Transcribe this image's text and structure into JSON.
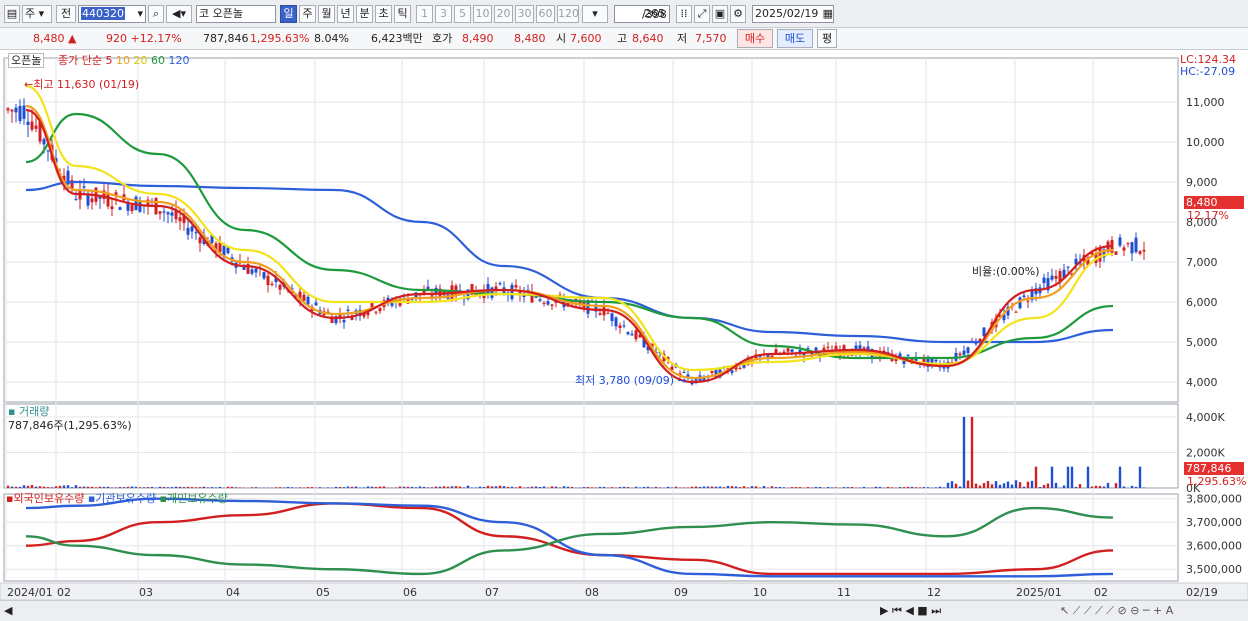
{
  "toolbar": {
    "market": "주",
    "market2": "전",
    "code": "440320",
    "prefix": "코",
    "name": "오픈놀",
    "periods": [
      "일",
      "주",
      "월",
      "년",
      "분",
      "초",
      "틱"
    ],
    "intervals": [
      "1",
      "3",
      "5",
      "10",
      "20",
      "30",
      "60",
      "120"
    ],
    "count": "265",
    "total": "/398",
    "date": "2025/02/19"
  },
  "quote": {
    "price": "8,480",
    "change_arrow": "▲",
    "change": "920",
    "change_pct": "+12.17%",
    "volume": "787,846",
    "volume_pct": "1,295.63%",
    "turnover": "8.04%",
    "amount": "6,423백만",
    "bid_label": "호가",
    "bid1": "8,490",
    "bid2": "8,480",
    "open_label": "시",
    "open": "7,600",
    "high_label": "고",
    "high": "8,640",
    "low_label": "저",
    "low": "7,570",
    "buy": "매수",
    "sell": "매도",
    "eval": "평"
  },
  "price_panel": {
    "legend_name": "오픈놀",
    "legend_title": "종가 단순",
    "ma_periods": [
      "5",
      "10",
      "20",
      "60",
      "120"
    ],
    "ma_colors": [
      "#d21f1f",
      "#f0a020",
      "#f2e31a",
      "#1e9a3c",
      "#2e5fd8"
    ],
    "high_marker": "최고 11,630 (01/19)",
    "low_marker": "최저 3,780 (09/09)",
    "note": "비율:",
    "note2": "(0.00%)",
    "lc": "LC:124.34",
    "hc": "HC:-27.09",
    "last_price": "8,480",
    "last_pct": "12.17%",
    "y_ticks": [
      "11,000",
      "10,000",
      "9,000",
      "8,000",
      "7,000",
      "6,000",
      "5,000",
      "4,000"
    ]
  },
  "volume_panel": {
    "title": "거래량",
    "info": "787,846주(1,295.63%)",
    "y_ticks": [
      "4,000K",
      "2,000K",
      "0K"
    ],
    "last": "787,846",
    "last_pct": "1,295.63%"
  },
  "holdings_panel": {
    "series": [
      "외국인보유수량",
      "기관보유수량",
      "개인보유수량"
    ],
    "colors": [
      "#d21f1f",
      "#2e5fd8",
      "#2f8f4f"
    ],
    "y_ticks": [
      "3,800,000",
      "3,700,000",
      "3,600,000",
      "3,500,000"
    ]
  },
  "x_axis": [
    "2024/01",
    "02",
    "03",
    "04",
    "05",
    "06",
    "07",
    "08",
    "09",
    "10",
    "11",
    "12",
    "2025/01",
    "02",
    "02/19"
  ],
  "chart_data": [
    {
      "type": "candlestick",
      "title": "종가 단순",
      "series": [
        {
          "name": "5",
          "x": [
            "2024/01",
            "02",
            "03",
            "04",
            "05",
            "06",
            "07",
            "08",
            "09",
            "10",
            "11",
            "12",
            "2025/01",
            "02"
          ],
          "values": [
            10800,
            8700,
            8400,
            6900,
            5600,
            6200,
            6300,
            5800,
            4000,
            4700,
            4800,
            4400,
            6300,
            7400
          ]
        },
        {
          "name": "10",
          "x": [
            "2024/01",
            "02",
            "03",
            "04",
            "05",
            "06",
            "07",
            "08",
            "09",
            "10",
            "11",
            "12",
            "2025/01",
            "02"
          ],
          "values": [
            10900,
            8800,
            8500,
            7000,
            5700,
            6100,
            6300,
            5900,
            4100,
            4600,
            4750,
            4400,
            6100,
            7300
          ]
        },
        {
          "name": "20",
          "x": [
            "2024/01",
            "02",
            "03",
            "04",
            "05",
            "06",
            "07",
            "08",
            "09",
            "10",
            "11",
            "12",
            "2025/01",
            "02"
          ],
          "values": [
            11400,
            9400,
            8700,
            7300,
            6000,
            6000,
            6200,
            6100,
            4300,
            4500,
            4700,
            4450,
            5600,
            7200
          ]
        },
        {
          "name": "60",
          "x": [
            "2024/01",
            "02",
            "03",
            "04",
            "05",
            "06",
            "07",
            "08",
            "09",
            "10",
            "11",
            "12",
            "2025/01",
            "02"
          ],
          "values": [
            9500,
            10700,
            9700,
            7800,
            6800,
            6300,
            6200,
            6000,
            5600,
            4900,
            4600,
            4600,
            5100,
            5900
          ]
        },
        {
          "name": "120",
          "x": [
            "2024/01",
            "02",
            "03",
            "04",
            "05",
            "06",
            "07",
            "08",
            "09",
            "10",
            "11",
            "12",
            "2025/01",
            "02"
          ],
          "values": [
            8800,
            9000,
            8900,
            8850,
            8800,
            8000,
            6900,
            6100,
            5600,
            5250,
            5150,
            5000,
            5000,
            5300
          ]
        }
      ],
      "ylim": [
        3500,
        12100
      ],
      "ticks": [
        11000,
        10000,
        9000,
        8000,
        7000,
        6000,
        5000,
        4000
      ],
      "annotations": [
        {
          "text": "최고 11,630 (01/19)",
          "x": "2024/01",
          "y": 11630
        },
        {
          "text": "최저 3,780 (09/09)",
          "x": "09",
          "y": 3780
        }
      ]
    },
    {
      "type": "bar",
      "title": "거래량",
      "x": [
        "2024/01",
        "02",
        "03",
        "04",
        "05",
        "06",
        "07",
        "08",
        "09",
        "10",
        "11",
        "12",
        "2025/01",
        "02"
      ],
      "values": [
        120000,
        60000,
        50000,
        40000,
        60000,
        90000,
        70000,
        50000,
        80000,
        40000,
        50000,
        4000000,
        1200000,
        787846
      ],
      "ylim": [
        0,
        4500000
      ],
      "ticks": [
        4000000,
        2000000,
        0
      ]
    },
    {
      "type": "line",
      "series": [
        {
          "name": "외국인보유수량",
          "values": [
            3600000,
            3620000,
            3700000,
            3730000,
            3780000,
            3760000,
            3640000,
            3560000,
            3540000,
            3480000,
            3480000,
            3480000,
            3500000,
            3580000
          ]
        },
        {
          "name": "기관보유수량",
          "values": [
            3760000,
            3770000,
            3800000,
            3790000,
            3780000,
            3770000,
            3700000,
            3560000,
            3480000,
            3470000,
            3470000,
            3470000,
            3470000,
            3480000
          ]
        },
        {
          "name": "개인보유수량",
          "values": [
            3640000,
            3600000,
            3560000,
            3520000,
            3500000,
            3480000,
            3580000,
            3650000,
            3680000,
            3700000,
            3690000,
            3640000,
            3760000,
            3720000
          ]
        }
      ],
      "ylim": [
        3450000,
        3820000
      ],
      "ticks": [
        3800000,
        3700000,
        3600000,
        3500000
      ]
    }
  ]
}
